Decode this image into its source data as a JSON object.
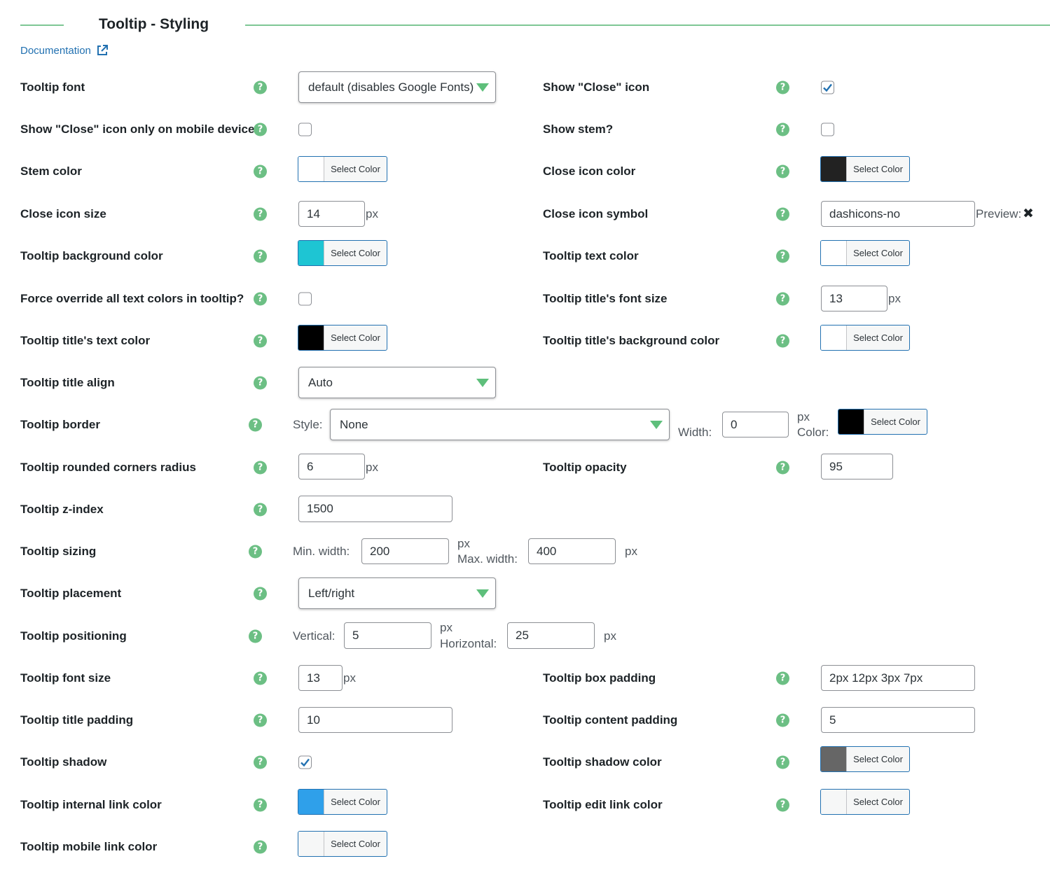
{
  "header": {
    "title": "Tooltip - Styling",
    "documentation_link": "Documentation",
    "external_link_icon": "external-link-icon"
  },
  "colors": {
    "accent_green": "#6cbf84",
    "link_blue": "#2271b1"
  },
  "common": {
    "help_glyph": "?",
    "select_color_label": "Select Color",
    "px": "px"
  },
  "left": {
    "tooltip_font": {
      "label": "Tooltip font",
      "value": "default (disables Google Fonts)"
    },
    "close_icon_mobile": {
      "label": "Show \"Close\" icon only on mobile devices",
      "checked": false
    },
    "stem_color": {
      "label": "Stem color",
      "swatch": "#ffffff"
    },
    "close_icon_size": {
      "label": "Close icon size",
      "value": "14"
    },
    "bg_color": {
      "label": "Tooltip background color",
      "swatch": "#1ec5d3"
    },
    "force_override": {
      "label": "Force override all text colors in tooltip?",
      "checked": false
    },
    "title_text_color": {
      "label": "Tooltip title's text color",
      "swatch": "#000000"
    },
    "title_align": {
      "label": "Tooltip title align",
      "value": "Auto"
    },
    "border": {
      "label": "Tooltip border",
      "style_label": "Style:",
      "style_value": "None",
      "width_label": "Width:",
      "width_value": "0",
      "color_label": "Color:",
      "swatch": "#000000"
    },
    "rounded_radius": {
      "label": "Tooltip rounded corners radius",
      "value": "6"
    },
    "z_index": {
      "label": "Tooltip z-index",
      "value": "1500"
    },
    "sizing": {
      "label": "Tooltip sizing",
      "min_label": "Min. width:",
      "min_value": "200",
      "max_label": "Max. width:",
      "max_value": "400"
    },
    "placement": {
      "label": "Tooltip placement",
      "value": "Left/right"
    },
    "positioning": {
      "label": "Tooltip positioning",
      "vertical_label": "Vertical:",
      "vertical_value": "5",
      "horizontal_label": "Horizontal:",
      "horizontal_value": "25"
    },
    "font_size": {
      "label": "Tooltip font size",
      "value": "13"
    },
    "title_padding": {
      "label": "Tooltip title padding",
      "value": "10"
    },
    "shadow": {
      "label": "Tooltip shadow",
      "checked": true
    },
    "internal_link_color": {
      "label": "Tooltip internal link color",
      "swatch": "#2fa0ea"
    },
    "mobile_link_color": {
      "label": "Tooltip mobile link color",
      "swatch": "#f6f7f7"
    }
  },
  "right": {
    "show_close_icon": {
      "label": "Show \"Close\" icon",
      "checked": true
    },
    "show_stem": {
      "label": "Show stem?",
      "checked": false
    },
    "close_icon_color": {
      "label": "Close icon color",
      "swatch": "#222222"
    },
    "close_icon_symbol": {
      "label": "Close icon symbol",
      "value": "dashicons-no",
      "preview_label": "Preview:",
      "preview_glyph": "✖"
    },
    "text_color": {
      "label": "Tooltip text color",
      "swatch": "#ffffff"
    },
    "title_font_size": {
      "label": "Tooltip title's font size",
      "value": "13"
    },
    "title_bg_color": {
      "label": "Tooltip title's background color",
      "swatch": "#ffffff"
    },
    "opacity": {
      "label": "Tooltip opacity",
      "value": "95"
    },
    "box_padding": {
      "label": "Tooltip box padding",
      "value": "2px 12px 3px 7px"
    },
    "content_padding": {
      "label": "Tooltip content padding",
      "value": "5"
    },
    "shadow_color": {
      "label": "Tooltip shadow color",
      "swatch": "#666666"
    },
    "edit_link_color": {
      "label": "Tooltip edit link color",
      "swatch": "#f6f7f7"
    }
  }
}
